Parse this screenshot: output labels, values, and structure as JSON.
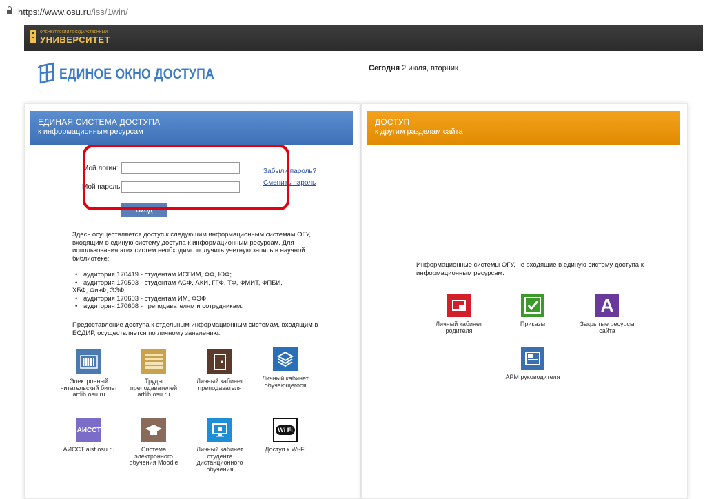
{
  "browser": {
    "url_host": "https://www.osu.ru",
    "url_path": "/iss/1win/"
  },
  "header": {
    "university_small": "ОРЕНБУРГСКИЙ ГОСУДАРСТВЕННЫЙ",
    "university": "УНИВЕРСИТЕТ",
    "portal_title": "ЕДИНОЕ ОКНО ДОСТУПА",
    "today_label": "Сегодня",
    "today_value": " 2 июля, вторник"
  },
  "left_panel": {
    "title": "ЕДИНАЯ СИСТЕМА ДОСТУПА",
    "subtitle": "к информационным ресурсам",
    "login_label": "Мой логин:",
    "password_label": "Мой пароль:",
    "login_value": "",
    "password_value": "",
    "forgot_link": "Забыли пароль?",
    "change_link": "Сменить пароль",
    "login_button": "Вход",
    "description": "Здесь осуществляется доступ к следующим информационным системам ОГУ, входящим в единую систему доступа к информационным ресурсам. Для использования этих систем необходимо получить учетную запись в научной библиотеке:",
    "list": [
      "аудитория 170419 - студентам ИСГИМ, ФФ, ЮФ;",
      "аудитория 170503 - студентам АСФ, АКИ, ГГФ, ТФ, ФМИТ, ФПБИ,",
      "ХБФ, ФизФ, ЭЭФ;",
      "аудитория 170603 - студентам ИМ, ФЭФ;",
      "аудитория 170608 - преподавателям и сотрудникам."
    ],
    "statement": "Предоставление доступа к отдельным информационным системам, входящим в ЕСДИР, осуществляется по личному заявлению.",
    "tiles": [
      {
        "label": "Электронный читательский билет artlib.osu.ru",
        "icon": "barcode-icon",
        "color": "#4a7ab0"
      },
      {
        "label": "Труды преподавателей artlib.osu.ru",
        "icon": "books-icon",
        "color": "#c9a24e"
      },
      {
        "label": "Личный кабинет преподавателя",
        "icon": "door-icon",
        "color": "#5a3a2a"
      },
      {
        "label": "Личный кабинет обучающегося",
        "icon": "layers-icon",
        "color": "#2a6fb8"
      },
      {
        "label": "АИССТ aist.osu.ru",
        "icon": "aisst-icon",
        "color": "#7b6dc7",
        "icon_text": "АИССТ"
      },
      {
        "label": "Система электронного обучения Moodle",
        "icon": "graduation-cap-icon",
        "color": "#8a6a5a"
      },
      {
        "label": "Личный кабинет студента дистанционного обучения",
        "icon": "monitor-icon",
        "color": "#1e8fd6"
      },
      {
        "label": "Доступ к Wi-Fi",
        "icon": "wifi-icon",
        "color": "#111111",
        "icon_text": "Wi Fi"
      }
    ]
  },
  "right_panel": {
    "title": "ДОСТУП",
    "subtitle": "к другим разделам сайта",
    "description": "Информационные системы ОГУ, не входящие в единую систему доступа к информационным ресурсам.",
    "tiles": [
      {
        "label": "Личный кабинет родителя",
        "icon": "parent-cabinet-icon",
        "color": "#d41f2a"
      },
      {
        "label": "Приказы",
        "icon": "checkmark-icon",
        "color": "#3c9a2a"
      },
      {
        "label": "Закрытые ресурсы сайта",
        "icon": "closed-resources-icon",
        "color": "#6a3a9a",
        "icon_text": "A"
      },
      {
        "label": "АРМ руководителя",
        "icon": "arm-icon",
        "color": "#3a6fb0"
      }
    ]
  },
  "colors": {
    "accent_blue": "#3d6fb5",
    "accent_orange": "#f4a21d",
    "highlight_red": "#e5000e",
    "link": "#2a4fa8"
  }
}
